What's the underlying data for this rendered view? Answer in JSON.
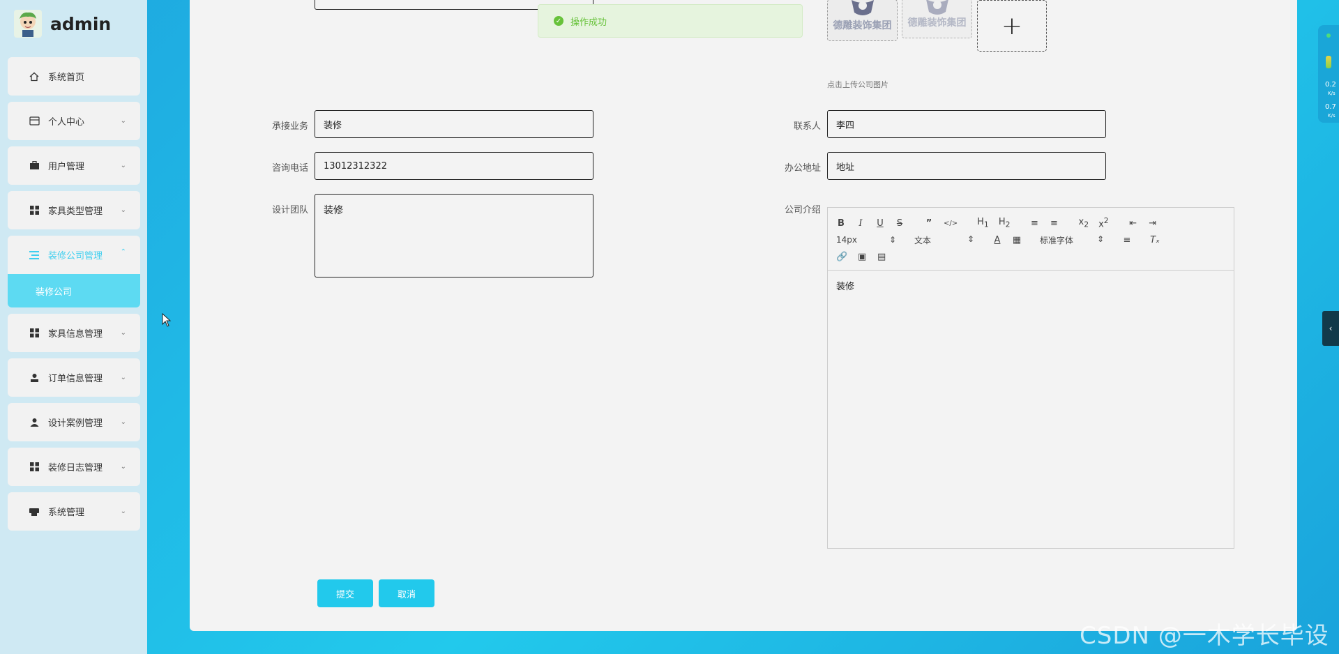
{
  "app": {
    "user": "admin"
  },
  "sidebar": {
    "items": [
      {
        "label": "系统首页",
        "icon": "home-icon"
      },
      {
        "label": "个人中心",
        "icon": "card-icon"
      },
      {
        "label": "用户管理",
        "icon": "briefcase-icon"
      },
      {
        "label": "家具类型管理",
        "icon": "grid-icon"
      },
      {
        "label": "装修公司管理",
        "icon": "list-icon",
        "active": true
      },
      {
        "label": "家具信息管理",
        "icon": "grid-icon"
      },
      {
        "label": "订单信息管理",
        "icon": "person-icon"
      },
      {
        "label": "设计案例管理",
        "icon": "person-icon"
      },
      {
        "label": "装修日志管理",
        "icon": "grid-icon"
      },
      {
        "label": "系统管理",
        "icon": "printer-icon"
      }
    ],
    "submenu": {
      "label": "装修公司"
    }
  },
  "toast": {
    "message": "操作成功",
    "color": "#67c23a"
  },
  "upload": {
    "thumb_text": "德雕装饰集团",
    "hint": "点击上传公司图片"
  },
  "form": {
    "business": {
      "label": "承接业务",
      "value": "装修"
    },
    "contact": {
      "label": "联系人",
      "value": "李四"
    },
    "phone": {
      "label": "咨询电话",
      "value": "13012312322"
    },
    "address": {
      "label": "办公地址",
      "value": "地址"
    },
    "team": {
      "label": "设计团队",
      "value": "装修"
    },
    "intro": {
      "label": "公司介绍",
      "value": "装修"
    }
  },
  "editor": {
    "font_size": "14px",
    "text_style": "文本",
    "font_family": "标准字体"
  },
  "buttons": {
    "submit": "提交",
    "cancel": "取消"
  },
  "side_widget": {
    "values": [
      "0.2",
      "0.7"
    ],
    "unit": "K/s"
  },
  "watermark": "CSDN @一木学长毕设",
  "colors": {
    "accent": "#22c9ec",
    "sidebar": "#cfe9f3",
    "panel": "#f3f3f3"
  }
}
